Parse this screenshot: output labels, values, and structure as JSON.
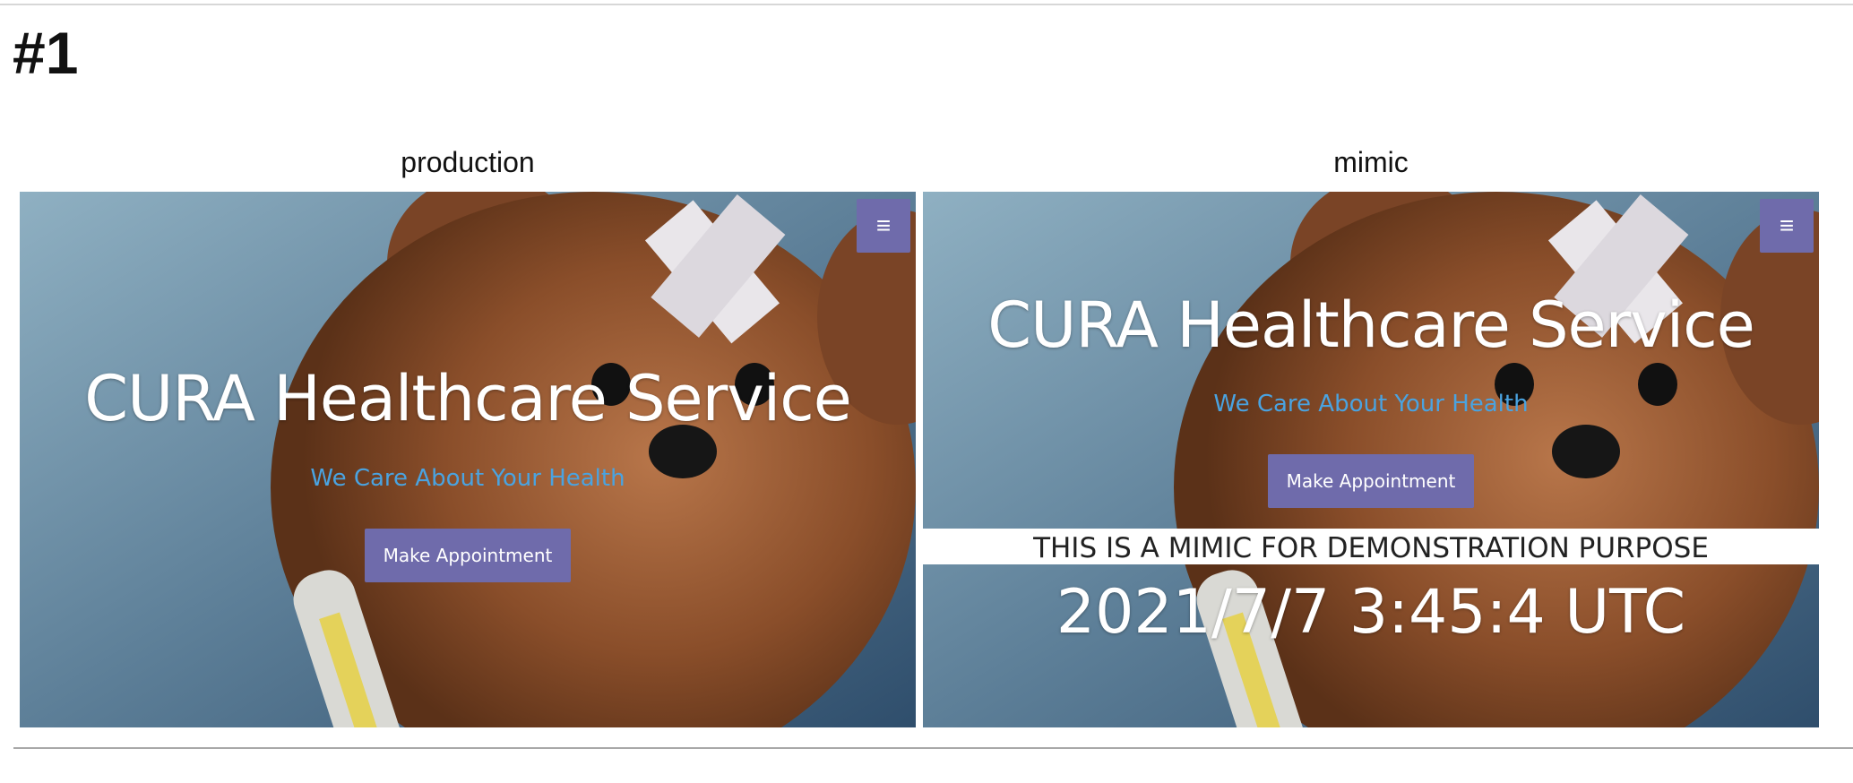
{
  "case": {
    "title": "#1"
  },
  "panels": {
    "left_label": "production",
    "right_label": "mimic"
  },
  "site": {
    "title": "CURA Healthcare Service",
    "subtitle": "We Care About Your Health",
    "button_label": "Make Appointment",
    "menu_icon": "≡"
  },
  "mimic": {
    "banner": "THIS IS A MIMIC FOR DEMONSTRATION PURPOSE",
    "timestamp": "2021/7/7 3:45:4 UTC"
  },
  "colors": {
    "accent": "#6f6bab",
    "subtitle": "#4aa3e0",
    "bg_blue": "#6f8ea5",
    "bear_brown": "#8a4e2a"
  }
}
